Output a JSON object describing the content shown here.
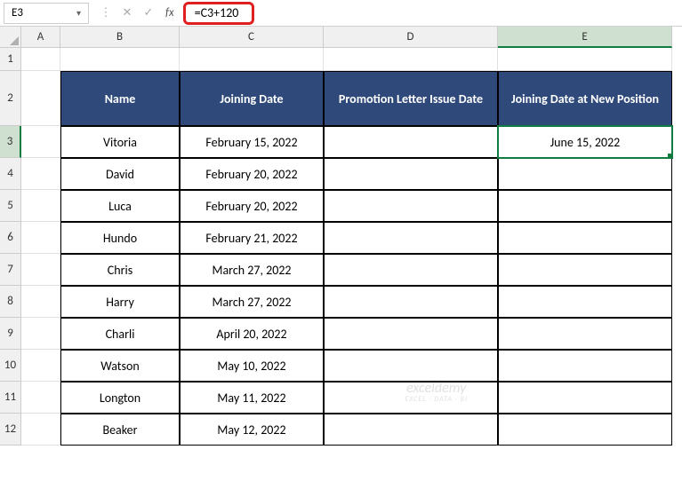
{
  "chart_data": {
    "type": "table",
    "columns": [
      "Name",
      "Joining Date",
      "Promotion Letter Issue Date",
      "Joining Date at New Position"
    ],
    "rows": [
      {
        "name": "Vitoria",
        "joining_date": "February 15, 2022",
        "promotion_date": "",
        "new_position_date": "June 15, 2022"
      },
      {
        "name": "David",
        "joining_date": "February 20, 2022",
        "promotion_date": "",
        "new_position_date": ""
      },
      {
        "name": "Luca",
        "joining_date": "February 20, 2022",
        "promotion_date": "",
        "new_position_date": ""
      },
      {
        "name": "Hundo",
        "joining_date": "February 21, 2022",
        "promotion_date": "",
        "new_position_date": ""
      },
      {
        "name": "Chris",
        "joining_date": "March 27, 2022",
        "promotion_date": "",
        "new_position_date": ""
      },
      {
        "name": "Harry",
        "joining_date": "March 27, 2022",
        "promotion_date": "",
        "new_position_date": ""
      },
      {
        "name": "Charli",
        "joining_date": "April 20, 2022",
        "promotion_date": "",
        "new_position_date": ""
      },
      {
        "name": "Watson",
        "joining_date": "May 10, 2022",
        "promotion_date": "",
        "new_position_date": ""
      },
      {
        "name": "Longton",
        "joining_date": "May 11, 2022",
        "promotion_date": "",
        "new_position_date": ""
      },
      {
        "name": "Beaker",
        "joining_date": "May 12, 2022",
        "promotion_date": "",
        "new_position_date": ""
      }
    ]
  },
  "formula_bar": {
    "cell_ref": "E3",
    "formula": "=C3+120"
  },
  "columns": [
    "A",
    "B",
    "C",
    "D",
    "E"
  ],
  "active_column": "E",
  "active_row": "3",
  "rows": [
    "1",
    "2",
    "3",
    "4",
    "5",
    "6",
    "7",
    "8",
    "9",
    "10",
    "11",
    "12"
  ],
  "headers": {
    "name": "Name",
    "joining": "Joining Date",
    "promotion": "Promotion Letter Issue Date",
    "new_pos": "Joining Date at New Position"
  },
  "watermark": {
    "main": "exceldemy",
    "sub": "EXCEL · DATA · BI"
  }
}
